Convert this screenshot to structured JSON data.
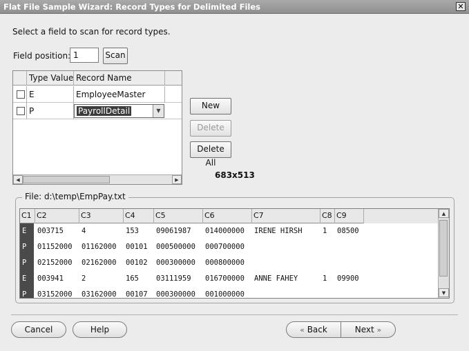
{
  "window": {
    "title": "Flat File Sample Wizard: Record Types for Delimited Files",
    "close_glyph": "✕"
  },
  "instruction": "Select a field to scan for record types.",
  "field_position": {
    "label": "Field position:",
    "value": "1",
    "scan_label": "Scan"
  },
  "record_table": {
    "headers": [
      "Type Value",
      "Record Name"
    ],
    "rows": [
      {
        "type_value": "E",
        "record_name": "EmployeeMaster"
      },
      {
        "type_value": "P",
        "record_name": "PayrollDetail"
      }
    ]
  },
  "buttons": {
    "new": "New",
    "delete": "Delete",
    "delete_all": "Delete All"
  },
  "dimensions_label": "683x513",
  "file": {
    "legend": "File: d:\\temp\\EmpPay.txt",
    "columns": [
      "C1",
      "C2",
      "C3",
      "C4",
      "C5",
      "C6",
      "C7",
      "C8",
      "C9"
    ],
    "rows": [
      [
        "E",
        "003715",
        "4",
        "153",
        "09061987",
        "014000000",
        "IRENE HIRSH",
        "1",
        "08500"
      ],
      [
        "P",
        "01152000",
        "01162000",
        "00101",
        "000500000",
        "000700000",
        "",
        "",
        ""
      ],
      [
        "P",
        "02152000",
        "02162000",
        "00102",
        "000300000",
        "000800000",
        "",
        "",
        ""
      ],
      [
        "E",
        "003941",
        "2",
        "165",
        "03111959",
        "016700000",
        "ANNE FAHEY",
        "1",
        "09900"
      ],
      [
        "P",
        "03152000",
        "03162000",
        "00107",
        "000300000",
        "001000000",
        "",
        "",
        ""
      ]
    ]
  },
  "nav": {
    "cancel": "Cancel",
    "help": "Help",
    "back": "Back",
    "next": "Next"
  },
  "icons": {
    "checkbox": "checkbox-icon",
    "dropdown": "chevron-down-icon",
    "back": "chevron-left-icon",
    "next": "chevron-right-icon"
  }
}
